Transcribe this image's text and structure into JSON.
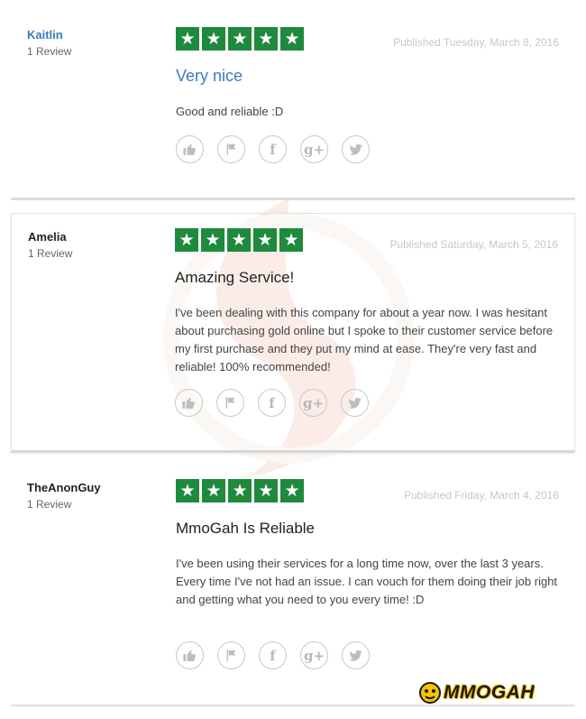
{
  "reviews": [
    {
      "author": "Kaitlin",
      "count": "1 Review",
      "stars": 5,
      "date": "Published Tuesday, March 8, 2016",
      "title": "Very nice",
      "body": "Good and reliable :D"
    },
    {
      "author": "Amelia",
      "count": "1 Review",
      "stars": 5,
      "date": "Published Saturday, March 5, 2016",
      "title": "Amazing Service!",
      "body": "I've been dealing with this company for about a year now. I was hesitant about purchasing gold online but I spoke to their customer service before my first purchase and they put my mind at ease. They're very fast and reliable! 100% recommended!"
    },
    {
      "author": "TheAnonGuy",
      "count": "1 Review",
      "stars": 5,
      "date": "Published Friday, March 4, 2016",
      "title": "MmoGah Is Reliable",
      "body": "I've been using their services for a long time now, over the last 3 years. Every time I've not had an issue. I can vouch for them doing their job right and getting what you need to you every time! :D"
    }
  ],
  "share_icons": [
    "thumbs-up-icon",
    "flag-icon",
    "facebook-icon",
    "google-plus-icon",
    "twitter-icon"
  ],
  "share_glyphs": {
    "facebook": "f",
    "google_plus": "g+"
  },
  "colors": {
    "star_green": "#1e8a3e",
    "link_blue": "#3a7bbf",
    "date_gray": "#c7c7c7"
  },
  "brand": {
    "logo_text": "MMOGAH"
  }
}
